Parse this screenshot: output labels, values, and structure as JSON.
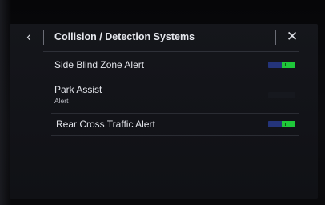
{
  "header": {
    "back_icon": "chevron-left-icon",
    "back_glyph": "‹",
    "title": "Collision / Detection Systems",
    "close_icon": "close-icon",
    "close_glyph": "✕"
  },
  "settings": [
    {
      "label": "Side Blind Zone Alert",
      "sublabel": "",
      "toggle_on": true
    },
    {
      "label": "Park Assist",
      "sublabel": "Alert",
      "toggle_on": null
    },
    {
      "label": "Rear Cross Traffic Alert",
      "sublabel": "",
      "toggle_on": true
    }
  ],
  "colors": {
    "toggle_on": "#1fc83a",
    "toggle_track": "#24347a",
    "text": "#e2e4ea",
    "background": "#121318"
  }
}
